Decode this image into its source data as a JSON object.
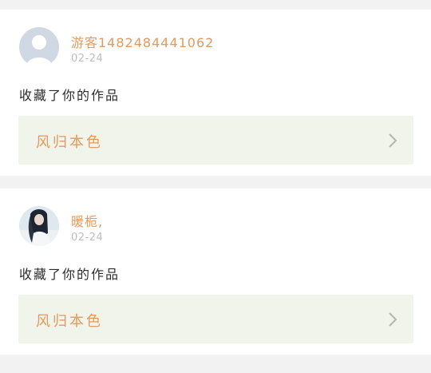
{
  "feed": {
    "items": [
      {
        "username": "游客1482484441062",
        "date": "02-24",
        "action": "收藏了你的作品",
        "work_title": "风归本色",
        "avatar_icon": "default-user-avatar-icon"
      },
      {
        "username": "暖栀,",
        "date": "02-24",
        "action": "收藏了你的作品",
        "work_title": "风归本色",
        "avatar_icon": "photo-avatar"
      }
    ]
  },
  "colors": {
    "accent": "#e39a5e",
    "date": "#bdbdbd",
    "work_box": "#f1f4ea",
    "background": "#f2f2f2"
  }
}
